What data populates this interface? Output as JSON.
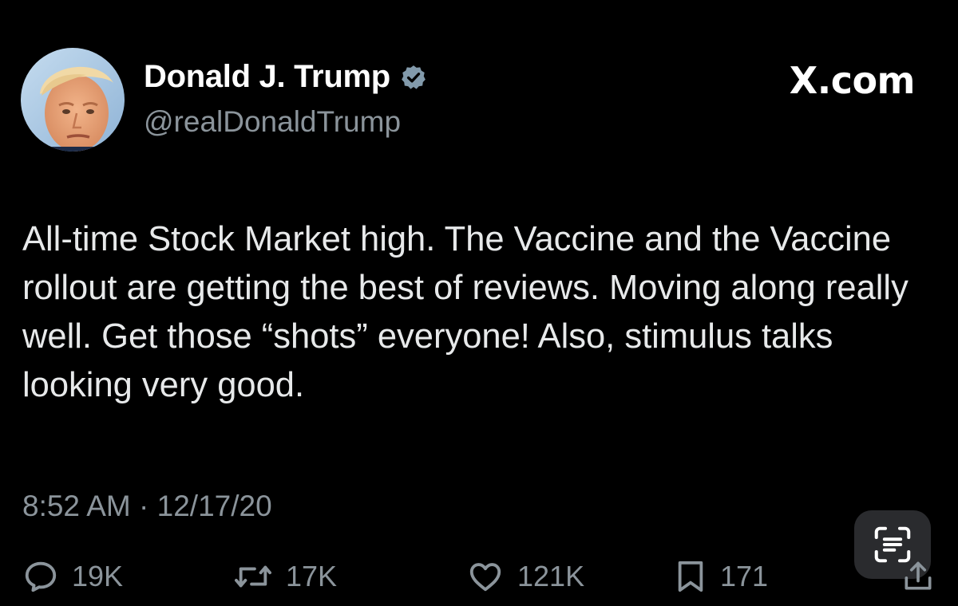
{
  "author": {
    "display_name": "Donald J. Trump",
    "handle": "@realDonaldTrump",
    "verified": true
  },
  "site_logo": "X.com",
  "tweet": {
    "text": "All-time Stock Market high. The Vaccine and the Vaccine rollout are getting the best of reviews. Moving along really well. Get those “shots” everyone! Also, stimulus talks looking very good.",
    "timestamp": "8:52 AM · 12/17/20"
  },
  "actions": {
    "replies": "19K",
    "retweets": "17K",
    "likes": "121K",
    "bookmarks": "171"
  },
  "colors": {
    "background": "#000000",
    "text": "#e7e9ea",
    "secondary": "#8b949b",
    "verified_badge": "#829aab"
  }
}
